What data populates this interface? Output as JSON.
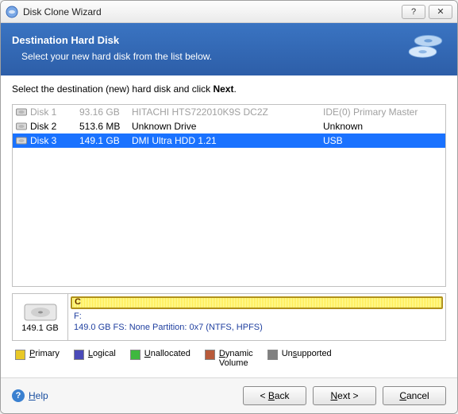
{
  "titlebar": {
    "title": "Disk Clone Wizard"
  },
  "banner": {
    "heading": "Destination Hard Disk",
    "sub": "Select your new hard disk from the list below."
  },
  "instruction_prefix": "Select the destination (new) hard disk and click ",
  "instruction_bold": "Next",
  "instruction_suffix": ".",
  "disks": [
    {
      "name": "Disk 1",
      "size": "93.16 GB",
      "model": "HITACHI HTS722010K9S DC2Z",
      "bus": "IDE(0) Primary Master",
      "disabled": true,
      "selected": false
    },
    {
      "name": "Disk 2",
      "size": "513.6 MB",
      "model": "Unknown Drive",
      "bus": "Unknown",
      "disabled": false,
      "selected": false
    },
    {
      "name": "Disk 3",
      "size": "149.1 GB",
      "model": "DMI Ultra HDD 1.21",
      "bus": "USB",
      "disabled": false,
      "selected": true
    }
  ],
  "detail": {
    "size": "149.1 GB",
    "part_label": "C",
    "drive": "F:",
    "fs_line": "149.0 GB  FS: None Partition: 0x7 (NTFS, HPFS)"
  },
  "legend": {
    "primary": "Primary",
    "logical": "Logical",
    "unallocated": "Unallocated",
    "dynamic_line1": "Dynamic",
    "dynamic_line2": "Volume",
    "unsupported": "Unsupported"
  },
  "footer": {
    "help": "Help",
    "back": "< Back",
    "next": "Next >",
    "cancel": "Cancel"
  }
}
